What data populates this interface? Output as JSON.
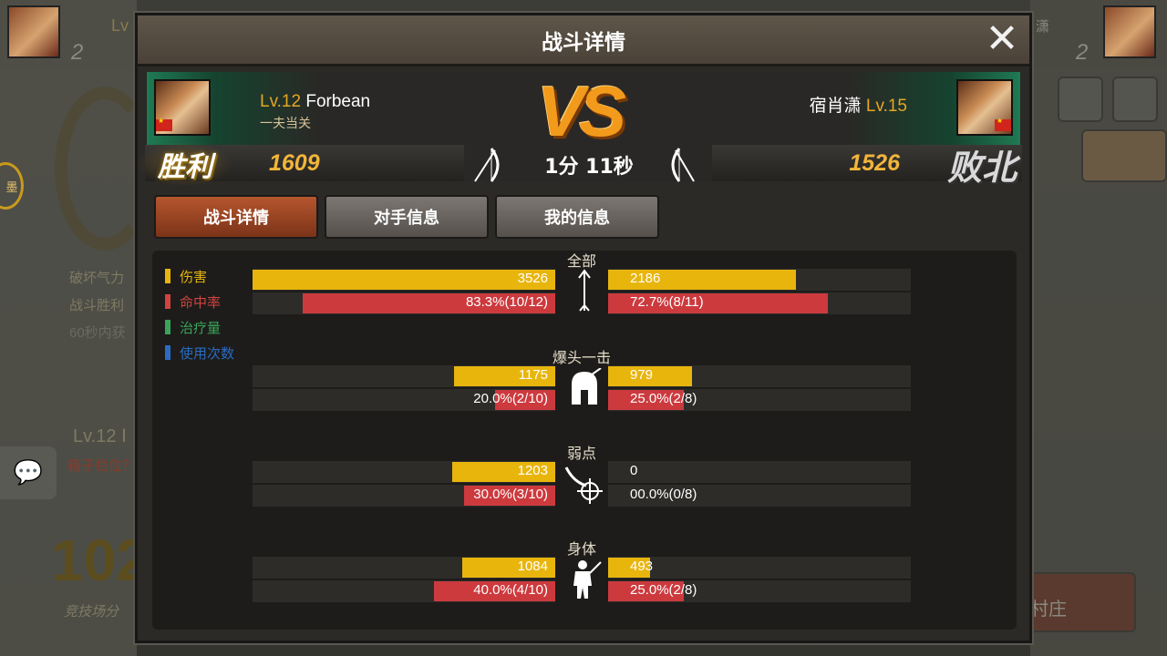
{
  "dialog": {
    "title": "战斗详情",
    "close_label": "✕"
  },
  "left_player": {
    "level_prefix": "Lv.12",
    "name": "Forbean",
    "title": "一夫当关",
    "score": "1609",
    "result": "胜利"
  },
  "right_player": {
    "name": "宿肖潇",
    "level_prefix": "Lv.15",
    "score": "1526",
    "result": "败北"
  },
  "vs_label": "VS",
  "battle_time": "1分 11秒",
  "tabs": [
    {
      "label": "战斗详情",
      "active": true
    },
    {
      "label": "对手信息",
      "active": false
    },
    {
      "label": "我的信息",
      "active": false
    }
  ],
  "legend": [
    {
      "label": "伤害",
      "color": "#e8b50d"
    },
    {
      "label": "命中率",
      "color": "#d2433f"
    },
    {
      "label": "治疗量",
      "color": "#3aa55a"
    },
    {
      "label": "使用次数",
      "color": "#2a6cc4"
    }
  ],
  "sections": [
    {
      "title": "全部",
      "icon": "arrow-icon",
      "left": {
        "damage": "3526",
        "damage_frac": 1.0,
        "hit": "83.3%(10/12)",
        "hit_frac": 0.833
      },
      "right": {
        "damage": "2186",
        "damage_frac": 0.62,
        "hit": "72.7%(8/11)",
        "hit_frac": 0.727
      }
    },
    {
      "title": "爆头一击",
      "icon": "helmet-icon",
      "left": {
        "damage": "1175",
        "damage_frac": 0.333,
        "hit": "20.0%(2/10)",
        "hit_frac": 0.2
      },
      "right": {
        "damage": "979",
        "damage_frac": 0.278,
        "hit": "25.0%(2/8)",
        "hit_frac": 0.25
      }
    },
    {
      "title": "弱点",
      "icon": "target-icon",
      "left": {
        "damage": "1203",
        "damage_frac": 0.341,
        "hit": "30.0%(3/10)",
        "hit_frac": 0.3
      },
      "right": {
        "damage": "0",
        "damage_frac": 0,
        "hit": "00.0%(0/8)",
        "hit_frac": 0
      }
    },
    {
      "title": "身体",
      "icon": "body-icon",
      "left": {
        "damage": "1084",
        "damage_frac": 0.307,
        "hit": "40.0%(4/10)",
        "hit_frac": 0.4
      },
      "right": {
        "damage": "493",
        "damage_frac": 0.14,
        "hit": "25.0%(2/8)",
        "hit_frac": 0.25
      }
    }
  ],
  "background": {
    "left_texts": [
      "破坏气力",
      "战斗胜利",
      "60秒内获",
      "Lv.12 Ⅰ",
      "箱子栏位？",
      "102",
      "竞技场分"
    ],
    "right_texts": [
      "潇",
      "村庄"
    ],
    "badge_char": "墨",
    "top_rank_left": "2",
    "top_rank_right": "2",
    "top_lv_left": "Lv"
  }
}
